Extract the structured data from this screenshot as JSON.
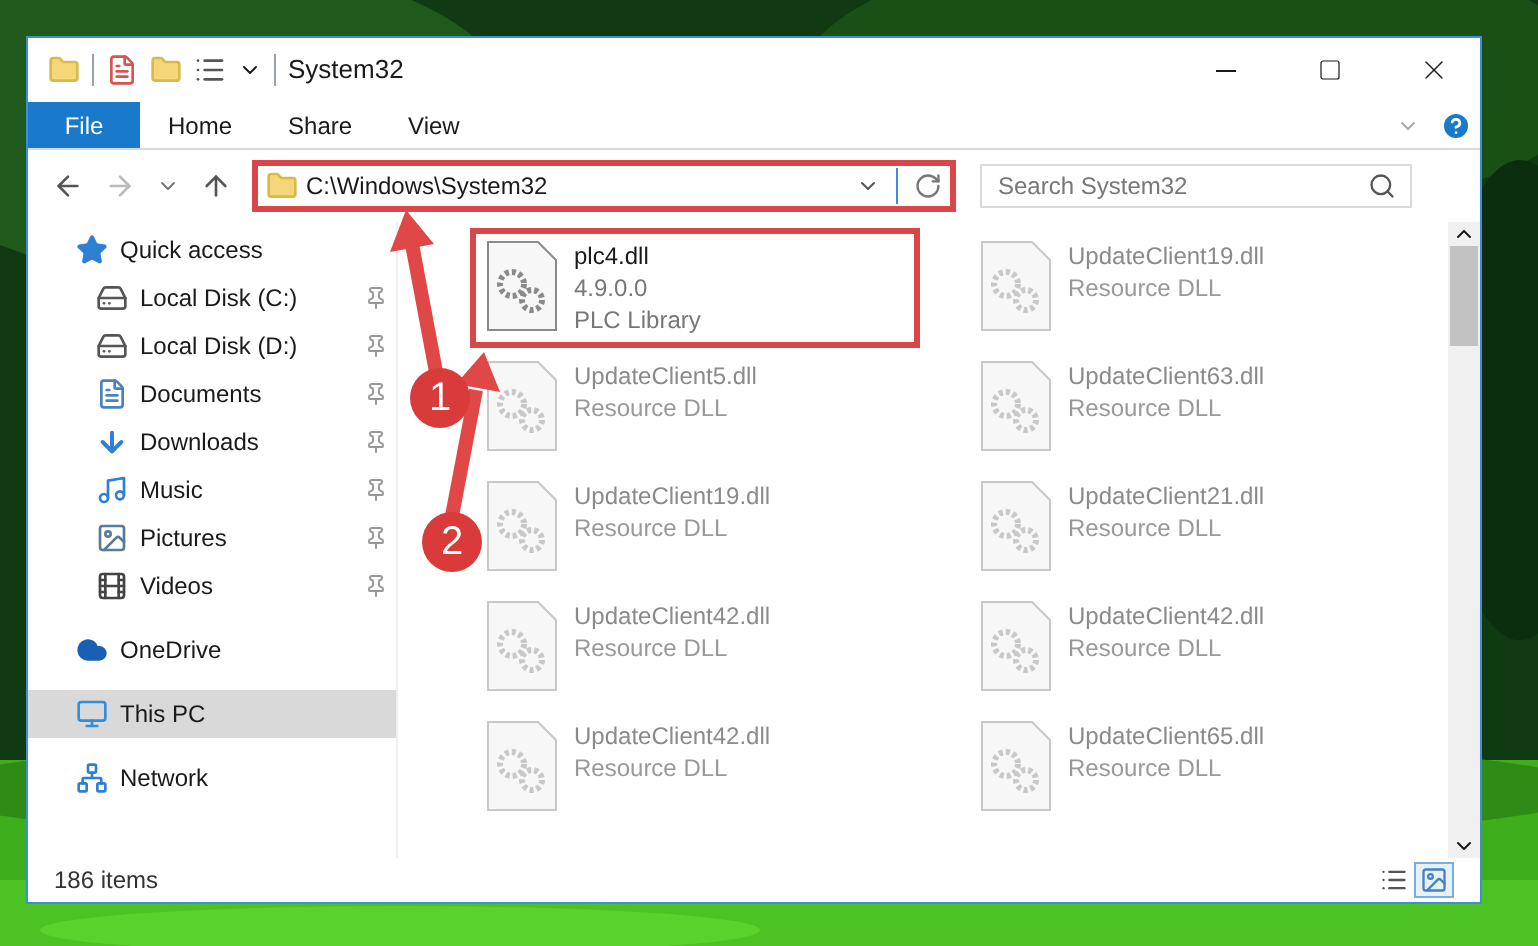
{
  "window": {
    "title": "System32"
  },
  "ribbon_tabs": [
    {
      "label": "File",
      "kind": "file_menu"
    },
    {
      "label": "Home",
      "kind": "tab"
    },
    {
      "label": "Share",
      "kind": "tab"
    },
    {
      "label": "View",
      "kind": "tab"
    }
  ],
  "address": {
    "path": "C:\\Windows\\System32"
  },
  "search": {
    "placeholder": "Search System32"
  },
  "nav": [
    {
      "label": "Quick access",
      "kind": "star",
      "selected": false,
      "children": [
        {
          "label": "Local Disk (C:)",
          "kind": "drive_c",
          "pinned": true
        },
        {
          "label": "Local Disk (D:)",
          "kind": "drive",
          "pinned": true
        },
        {
          "label": "Documents",
          "kind": "documents",
          "pinned": true
        },
        {
          "label": "Downloads",
          "kind": "downloads",
          "pinned": true
        },
        {
          "label": "Music",
          "kind": "music",
          "pinned": true
        },
        {
          "label": "Pictures",
          "kind": "pictures",
          "pinned": true
        },
        {
          "label": "Videos",
          "kind": "videos",
          "pinned": true
        }
      ]
    },
    {
      "label": "OneDrive",
      "kind": "cloud",
      "selected": false
    },
    {
      "label": "This PC",
      "kind": "pc",
      "selected": true
    },
    {
      "label": "Network",
      "kind": "network",
      "selected": false
    }
  ],
  "files": [
    {
      "name": "plc4.dll",
      "version": "4.9.0.0",
      "description": "PLC Library",
      "blurred": false
    },
    {
      "name": "UpdateClient19.dll",
      "description": "Resource DLL",
      "blurred": true
    },
    {
      "name": "UpdateClient5.dll",
      "description": "Resource DLL",
      "blurred": true
    },
    {
      "name": "UpdateClient63.dll",
      "description": "Resource DLL",
      "blurred": true
    },
    {
      "name": "UpdateClient19.dll",
      "description": "Resource DLL",
      "blurred": true
    },
    {
      "name": "UpdateClient21.dll",
      "description": "Resource DLL",
      "blurred": true
    },
    {
      "name": "UpdateClient42.dll",
      "description": "Resource DLL",
      "blurred": true
    },
    {
      "name": "UpdateClient42.dll",
      "description": "Resource DLL",
      "blurred": true
    },
    {
      "name": "UpdateClient42.dll",
      "description": "Resource DLL",
      "blurred": true
    },
    {
      "name": "UpdateClient65.dll",
      "description": "Resource DLL",
      "blurred": true
    }
  ],
  "status_bar": {
    "count": "186 items"
  },
  "view_buttons": [
    {
      "kind": "details",
      "selected": false
    },
    {
      "kind": "large_icons",
      "selected": true
    }
  ],
  "callouts": [
    {
      "number": "1"
    },
    {
      "number": "2"
    }
  ]
}
